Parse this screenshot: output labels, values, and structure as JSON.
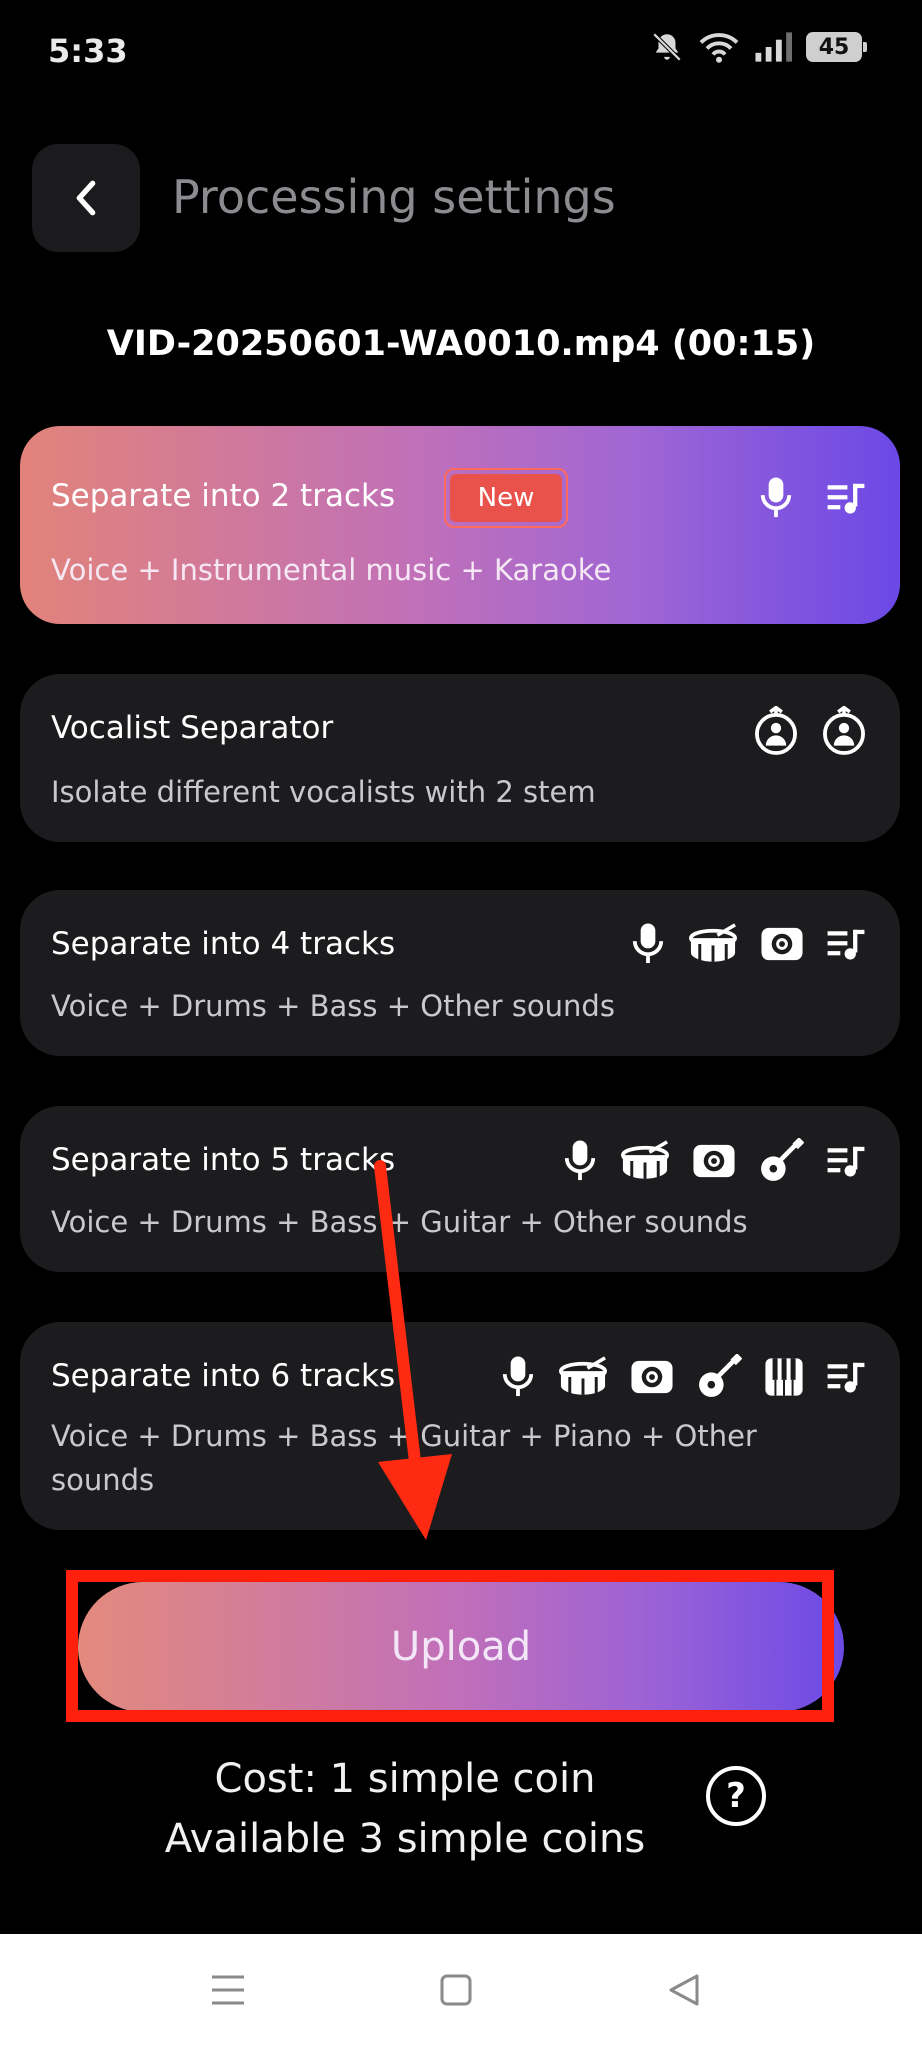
{
  "status_bar": {
    "time": "5:33",
    "battery": "45"
  },
  "header": {
    "title": "Processing settings"
  },
  "file": {
    "name": "VID-20250601-WA0010.mp4 (00:15)"
  },
  "options": [
    {
      "title": "Separate into 2 tracks",
      "badge": "New",
      "description": "Voice + Instrumental music + Karaoke",
      "icons": [
        "microphone-icon",
        "music-list-icon"
      ]
    },
    {
      "title": "Vocalist Separator",
      "description": "Isolate different vocalists with 2 stem",
      "icons": [
        "vocalist-icon",
        "vocalist-icon"
      ]
    },
    {
      "title": "Separate into 4 tracks",
      "description": "Voice + Drums + Bass + Other sounds",
      "icons": [
        "microphone-icon",
        "drum-icon",
        "speaker-icon",
        "music-list-icon"
      ]
    },
    {
      "title": "Separate into 5 tracks",
      "description": "Voice + Drums + Bass + Guitar + Other sounds",
      "icons": [
        "microphone-icon",
        "drum-icon",
        "speaker-icon",
        "guitar-icon",
        "music-list-icon"
      ]
    },
    {
      "title": "Separate into 6 tracks",
      "description": "Voice + Drums + Bass + Guitar + Piano + Other sounds",
      "icons": [
        "microphone-icon",
        "drum-icon",
        "speaker-icon",
        "guitar-icon",
        "piano-icon",
        "music-list-icon"
      ]
    }
  ],
  "upload": {
    "label": "Upload"
  },
  "cost": {
    "line1": "Cost: 1 simple coin",
    "line2": "Available 3 simple coins",
    "help": "?"
  },
  "colors": {
    "accent_start": "#e2837a",
    "accent_mid": "#c070b8",
    "accent_end": "#6b48e6",
    "highlight": "#ff1f0d",
    "card_bg": "#1c1c1f"
  }
}
